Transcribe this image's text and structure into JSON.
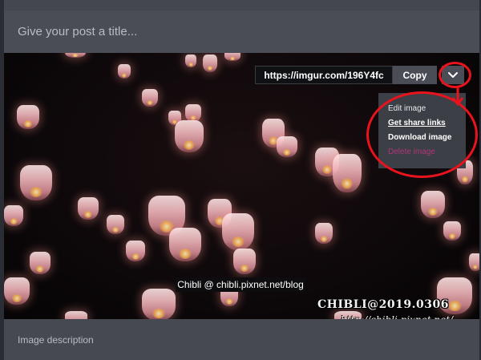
{
  "post": {
    "title_placeholder": "Give your post a title...",
    "description_placeholder": "Image description"
  },
  "share": {
    "url": "https://imgur.com/196Y4fc",
    "copy_label": "Copy"
  },
  "menu": {
    "items": [
      {
        "label": "Edit image"
      },
      {
        "label": "Get share links"
      },
      {
        "label": "Download image"
      },
      {
        "label": "Delete image"
      }
    ]
  },
  "image_overlay": {
    "caption": "Chibli @ chibli.pixnet.net/blog",
    "watermark_brand": "CHIBLI@2019.0306",
    "watermark_url": "http://chibli.pixnet.net/"
  },
  "colors": {
    "background": "#44474f",
    "annotation": "#e8131c",
    "delete": "#b0367c"
  },
  "icons": {
    "menu_toggle": "chevron-down-icon"
  }
}
